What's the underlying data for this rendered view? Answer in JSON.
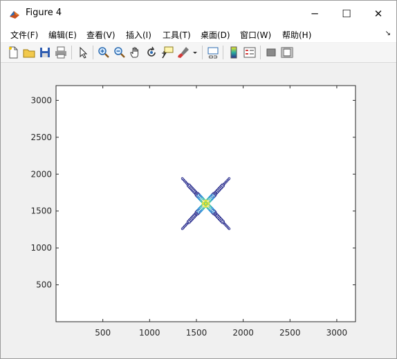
{
  "window": {
    "title": "Figure 4",
    "minimize_glyph": "─",
    "maximize_glyph": "☐",
    "close_glyph": "✕"
  },
  "menu": {
    "items": [
      "文件(F)",
      "编辑(E)",
      "查看(V)",
      "插入(I)",
      "工具(T)",
      "桌面(D)",
      "窗口(W)",
      "帮助(H)"
    ],
    "overflow_glyph": "↘"
  },
  "toolbar": {
    "icons": [
      "new-figure-icon",
      "open-file-icon",
      "save-icon",
      "print-icon",
      "edit-plot-arrow-icon",
      "zoom-in-icon",
      "zoom-out-icon",
      "pan-hand-icon",
      "rotate-3d-icon",
      "data-cursor-icon",
      "brush-icon",
      "brush-dropdown-icon",
      "link-plot-icon",
      "colorbar-icon",
      "legend-icon",
      "hide-plot-tools-icon",
      "show-plot-tools-icon"
    ]
  },
  "colors": {
    "marker_outer": "#2b2f8f",
    "marker_mid": "#1f8fd8",
    "marker_inner": "#3fc4a0",
    "marker_core": "#f5e620"
  },
  "chart_data": {
    "type": "scatter",
    "title": "",
    "xlabel": "",
    "ylabel": "",
    "xlim": [
      0,
      3200
    ],
    "ylim": [
      0,
      3200
    ],
    "xticks": [
      500,
      1000,
      1500,
      2000,
      2500,
      3000
    ],
    "yticks": [
      500,
      1000,
      1500,
      2000,
      2500,
      3000
    ],
    "grid": false,
    "description_points": "X-shaped cluster of circle markers centered near (1600, 1600), diagonals spanning approx x 1350–1850, y 1250–1950",
    "center": [
      1600,
      1600
    ],
    "arm_half_span_x": 250,
    "arm_half_span_y": 340
  }
}
